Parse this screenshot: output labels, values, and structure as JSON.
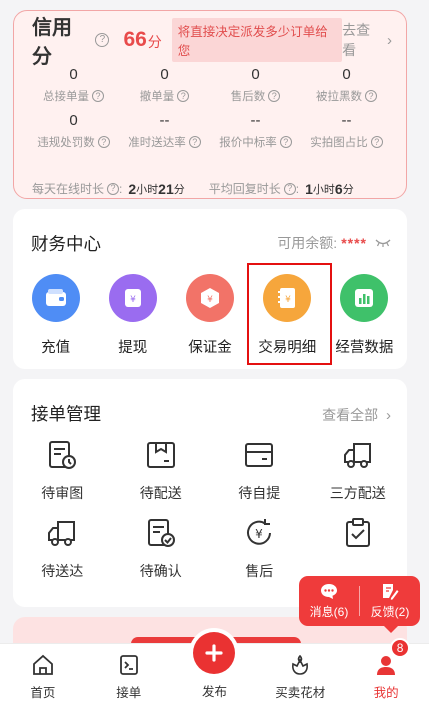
{
  "credit": {
    "title": "信用分",
    "score": "66",
    "score_unit": "分",
    "hint": "将直接决定派发多少订单给您",
    "go_see": "去查看",
    "stats": [
      {
        "value": "0",
        "label": "总接单量"
      },
      {
        "value": "0",
        "label": "撤单量"
      },
      {
        "value": "0",
        "label": "售后数"
      },
      {
        "value": "0",
        "label": "被拉黑数"
      },
      {
        "value": "0",
        "label": "违规处罚数"
      },
      {
        "value": "--",
        "label": "准时送达率"
      },
      {
        "value": "--",
        "label": "报价中标率"
      },
      {
        "value": "--",
        "label": "实拍图占比"
      }
    ],
    "online_label": "每天在线时长",
    "online_h": "2",
    "online_h_unit": "小时",
    "online_m": "21",
    "online_m_unit": "分",
    "reply_label": "平均回复时长",
    "reply_h": "1",
    "reply_h_unit": "小时",
    "reply_m": "6",
    "reply_m_unit": "分"
  },
  "finance": {
    "title": "财务中心",
    "balance_label": "可用余额:",
    "balance_value": "****",
    "items": [
      {
        "label": "充值",
        "icon": "wallet-icon",
        "color": "#4f8df5"
      },
      {
        "label": "提现",
        "icon": "withdraw-icon",
        "color": "#9a6cf0"
      },
      {
        "label": "保证金",
        "icon": "deposit-icon",
        "color": "#f27368"
      },
      {
        "label": "交易明细",
        "icon": "ledger-icon",
        "color": "#f6a63c"
      },
      {
        "label": "经营数据",
        "icon": "chart-icon",
        "color": "#3fc16a"
      }
    ]
  },
  "orders": {
    "title": "接单管理",
    "see_all": "查看全部",
    "items": [
      {
        "label": "待审图"
      },
      {
        "label": "待配送"
      },
      {
        "label": "待自提"
      },
      {
        "label": "三方配送"
      },
      {
        "label": "待送达"
      },
      {
        "label": "待确认"
      },
      {
        "label": "售后"
      }
    ]
  },
  "float": {
    "messages": "消息(6)",
    "feedback": "反馈(2)"
  },
  "tabbar": {
    "items": [
      {
        "label": "首页"
      },
      {
        "label": "接单"
      },
      {
        "label": "发布"
      },
      {
        "label": "买卖花材"
      },
      {
        "label": "我的",
        "badge": "8"
      }
    ],
    "active_color": "#e83535"
  }
}
